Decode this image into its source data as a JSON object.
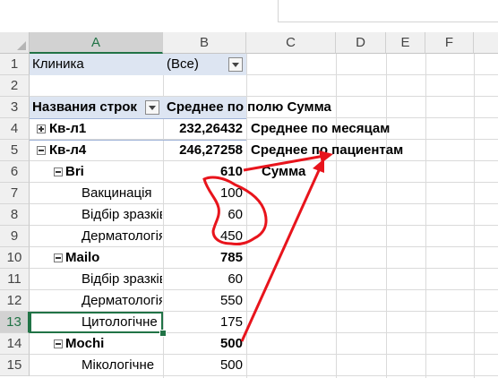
{
  "columns": [
    "A",
    "B",
    "C",
    "D",
    "E",
    "F"
  ],
  "selected_column": "A",
  "rows": [
    "1",
    "2",
    "3",
    "4",
    "5",
    "6",
    "7",
    "8",
    "9",
    "10",
    "11",
    "12",
    "13",
    "14",
    "15"
  ],
  "selected_row": "13",
  "filter": {
    "field": "Клиника",
    "value": "(Все)"
  },
  "pivot_headers": {
    "row_labels": "Названия строк",
    "value_header": "Среднее по полю Сумма"
  },
  "pivot_rows": [
    {
      "label": "Кв-л1",
      "value": "232,26432"
    },
    {
      "label": "Кв-л4",
      "value": "246,27258"
    },
    {
      "label": "Bri",
      "value": "610"
    },
    {
      "label": "Вакцинація",
      "value": "100"
    },
    {
      "label": "Відбір зразків",
      "value": "60"
    },
    {
      "label": "Дерматологія",
      "value": "450"
    },
    {
      "label": "Mailo",
      "value": "785"
    },
    {
      "label": "Відбір зразків",
      "value": "60"
    },
    {
      "label": "Дерматологія",
      "value": "550"
    },
    {
      "label": "Цитологічне",
      "value": "175"
    },
    {
      "label": "Mochi",
      "value": "500"
    },
    {
      "label": "Мікологічне",
      "value": "500"
    }
  ],
  "annotations": {
    "note_months": "Среднее по месяцам",
    "note_patients": "Среднее по пациентам",
    "note_sum": "Сумма",
    "arrow_color": "#e8141c"
  }
}
